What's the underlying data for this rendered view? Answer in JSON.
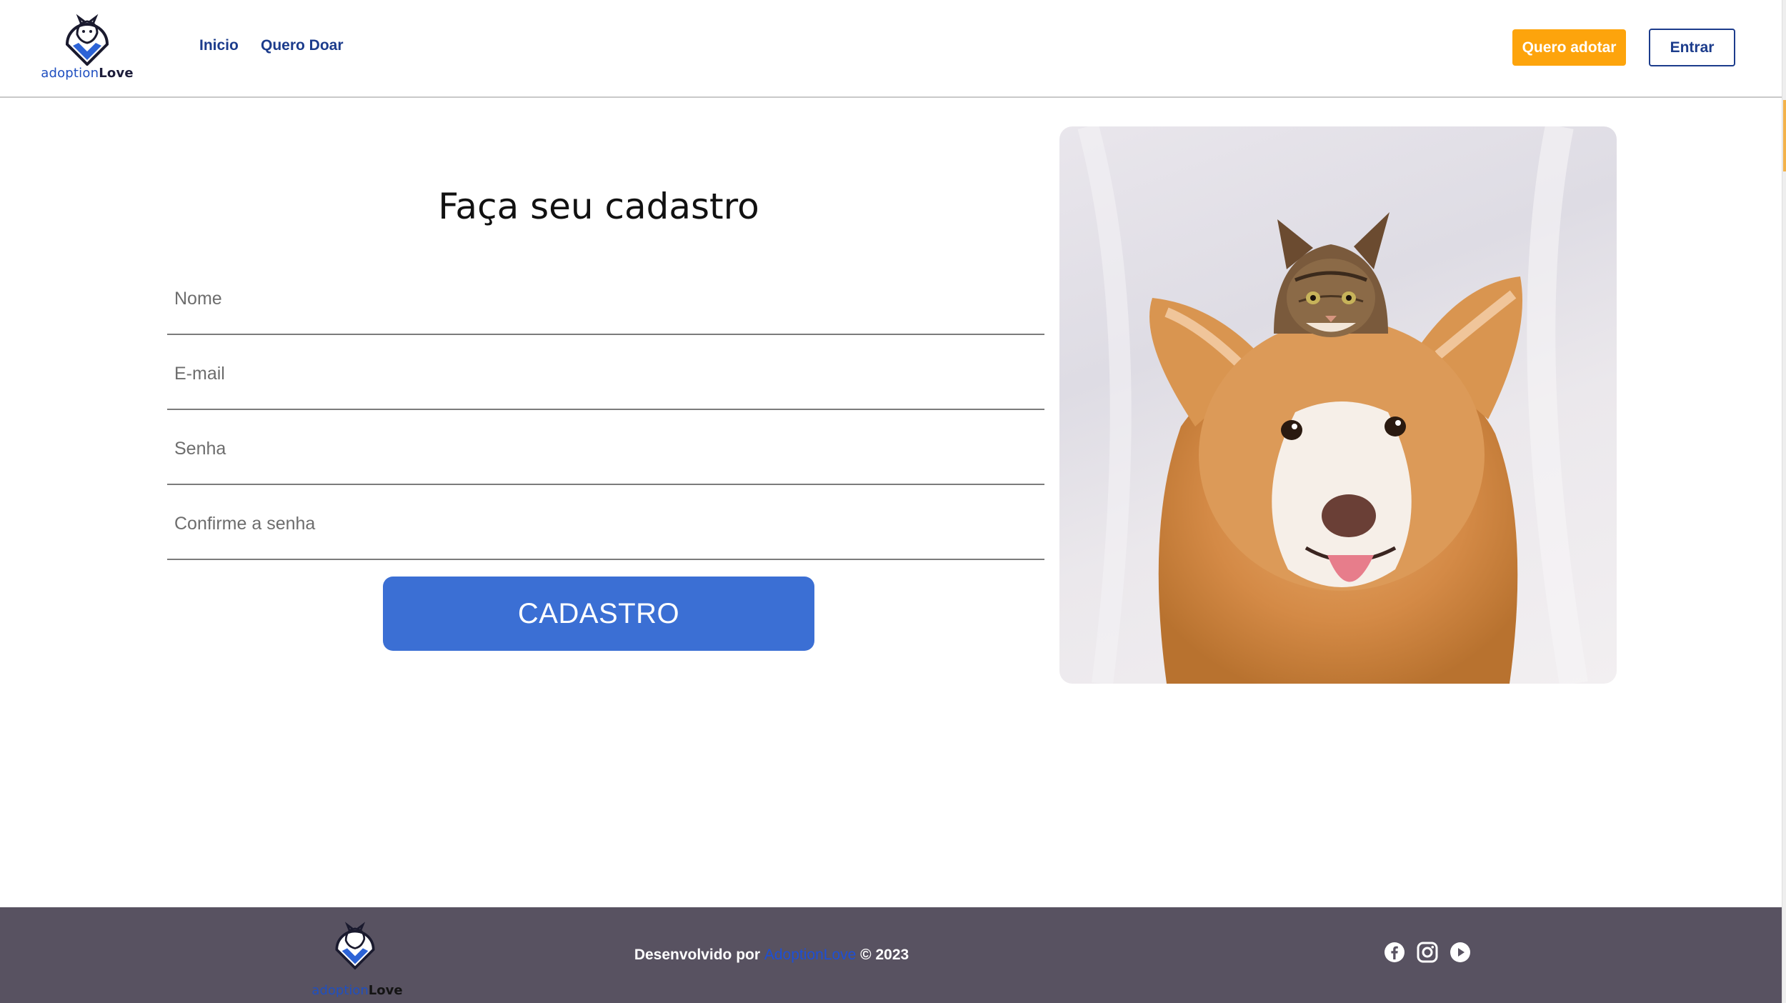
{
  "header": {
    "logo": {
      "word_part1": "adoption",
      "word_part2": "Love"
    },
    "nav": [
      {
        "label": "Inicio"
      },
      {
        "label": "Quero Doar"
      }
    ],
    "cta_adopt_label": "Quero adotar",
    "login_label": "Entrar"
  },
  "form": {
    "title": "Faça seu cadastro",
    "fields": [
      {
        "placeholder": "Nome",
        "value": ""
      },
      {
        "placeholder": "E-mail",
        "value": ""
      },
      {
        "placeholder": "Senha",
        "value": ""
      },
      {
        "placeholder": "Confirme a senha",
        "value": ""
      }
    ],
    "submit_label": "CADASTRO"
  },
  "footer": {
    "logo": {
      "word_part1": "adoption",
      "word_part2": "Love"
    },
    "credits_prefix": "Desenvolvido por",
    "credits_brand": "AdoptionLove",
    "credits_suffix": "© 2023",
    "socials": [
      "facebook-icon",
      "instagram-icon",
      "youtube-icon"
    ]
  },
  "colors": {
    "nav_text": "#1c3c8c",
    "cta_orange": "#fda40c",
    "submit_blue": "#3b6fd4",
    "footer_bg": "#585261",
    "brand_blue": "#1d4fd6"
  }
}
